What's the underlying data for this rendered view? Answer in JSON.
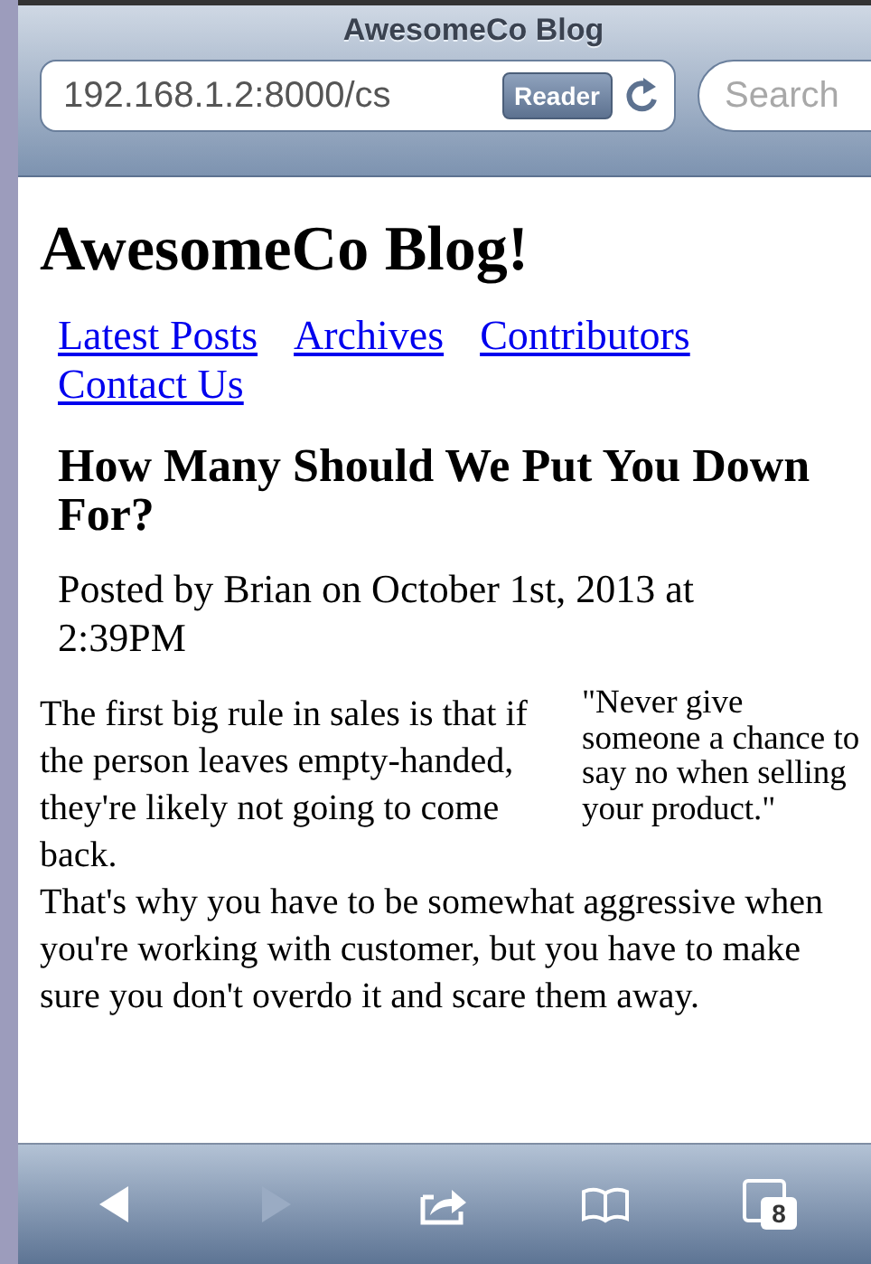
{
  "window": {
    "title": "AwesomeCo Blog"
  },
  "address_bar": {
    "value": "192.168.1.2:8000/cs",
    "reader_button": "Reader"
  },
  "search": {
    "placeholder": "Search"
  },
  "page": {
    "site_title": "AwesomeCo Blog!",
    "nav": [
      "Latest Posts",
      "Archives",
      "Contributors",
      "Contact Us"
    ],
    "post_title": "How Many Should We Put You Down For?",
    "byline": "Posted by Brian on October 1st, 2013 at 2:39PM",
    "pull_quote": "\"Never give someone a chance to say no when selling your product.\"",
    "body": [
      "The first big rule in sales is that if the person leaves empty-handed, they're likely not going to come back.",
      "That's why you have to be somewhat aggressive when you're working with customer, but you have to make sure you don't overdo it and scare them away."
    ]
  },
  "toolbar": [
    {
      "kind": "back",
      "disabled": false
    },
    {
      "kind": "forward",
      "disabled": true
    },
    {
      "kind": "share",
      "disabled": false
    },
    {
      "kind": "bookmarks",
      "disabled": false
    },
    {
      "kind": "tabs",
      "disabled": false,
      "count": "8"
    }
  ]
}
